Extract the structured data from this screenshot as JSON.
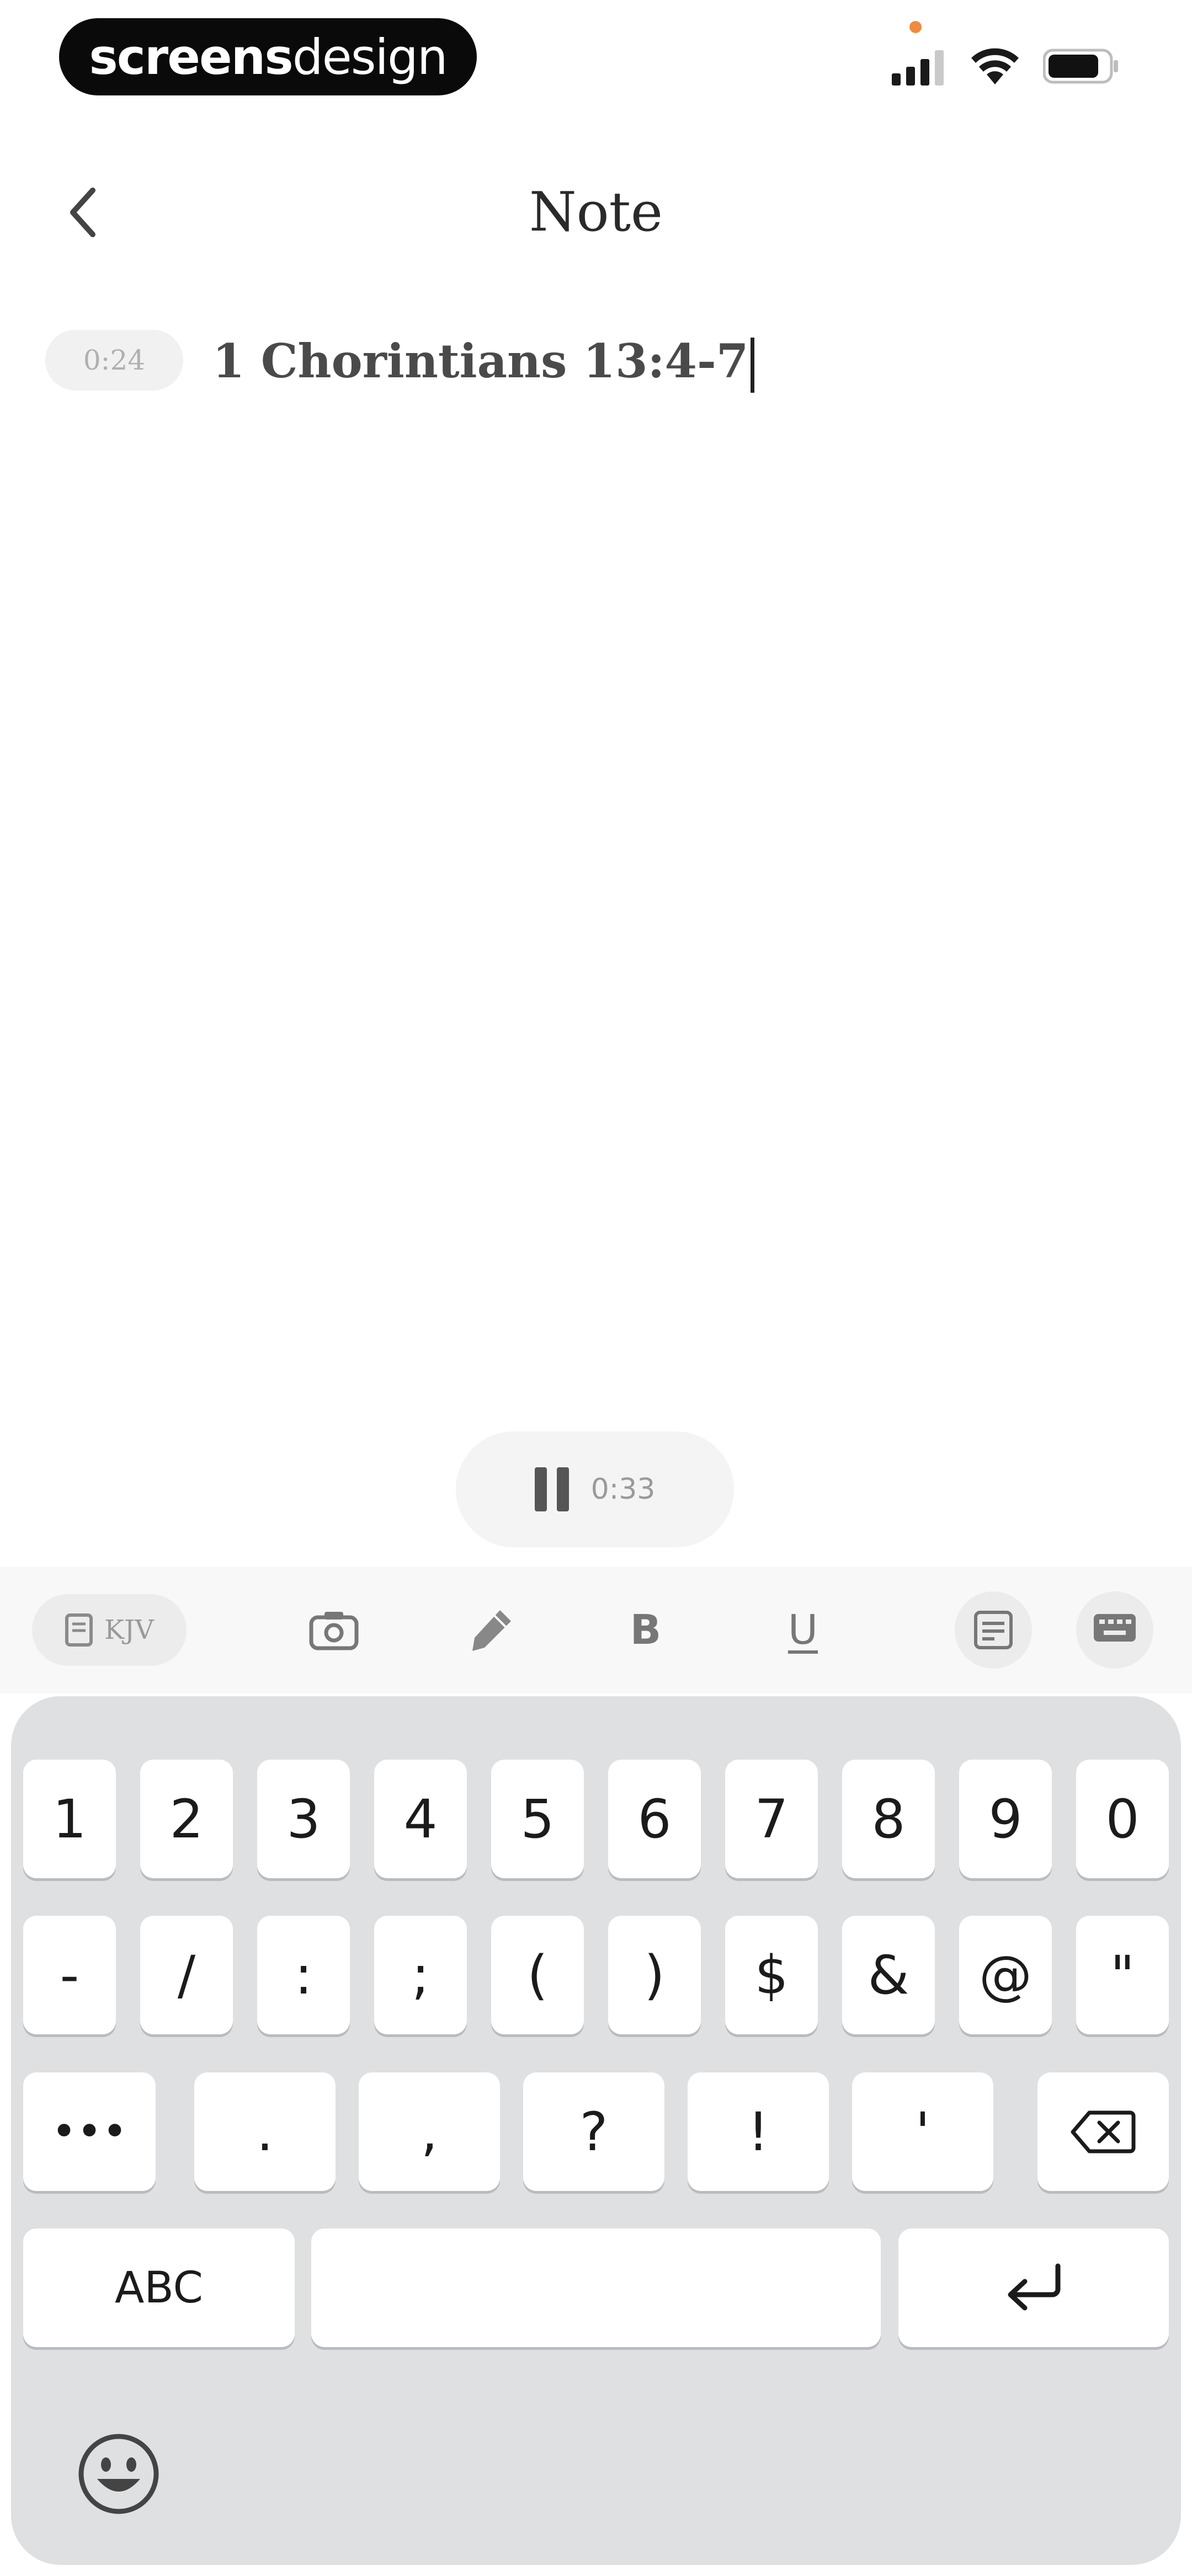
{
  "status_bar": {
    "logo_part1": "screens",
    "logo_part2": "design",
    "icons": [
      "signal-icon",
      "wifi-icon",
      "battery-icon"
    ]
  },
  "nav": {
    "title": "Note"
  },
  "note": {
    "timestamp": "0:24",
    "text": "1 Chorintians 13:4-7"
  },
  "recorder": {
    "time": "0:33"
  },
  "toolbar": {
    "version_label": "KJV",
    "tools": [
      "camera-icon",
      "highlight-pen-icon",
      "bold-icon",
      "underline-icon",
      "list-icon",
      "keyboard-icon"
    ],
    "bold_label": "B",
    "underline_label": "U"
  },
  "keyboard": {
    "row1": [
      "1",
      "2",
      "3",
      "4",
      "5",
      "6",
      "7",
      "8",
      "9",
      "0"
    ],
    "row2": [
      "-",
      "/",
      ":",
      ";",
      "(",
      ")",
      "$",
      "&",
      "@",
      "\""
    ],
    "row3": [
      "•••",
      ".",
      ",",
      "?",
      "!",
      "'"
    ],
    "abc_label": "ABC",
    "colors": {
      "background": "#dfe0e2",
      "key": "#ffffff",
      "key_shadow": "#b9bbbf"
    }
  }
}
